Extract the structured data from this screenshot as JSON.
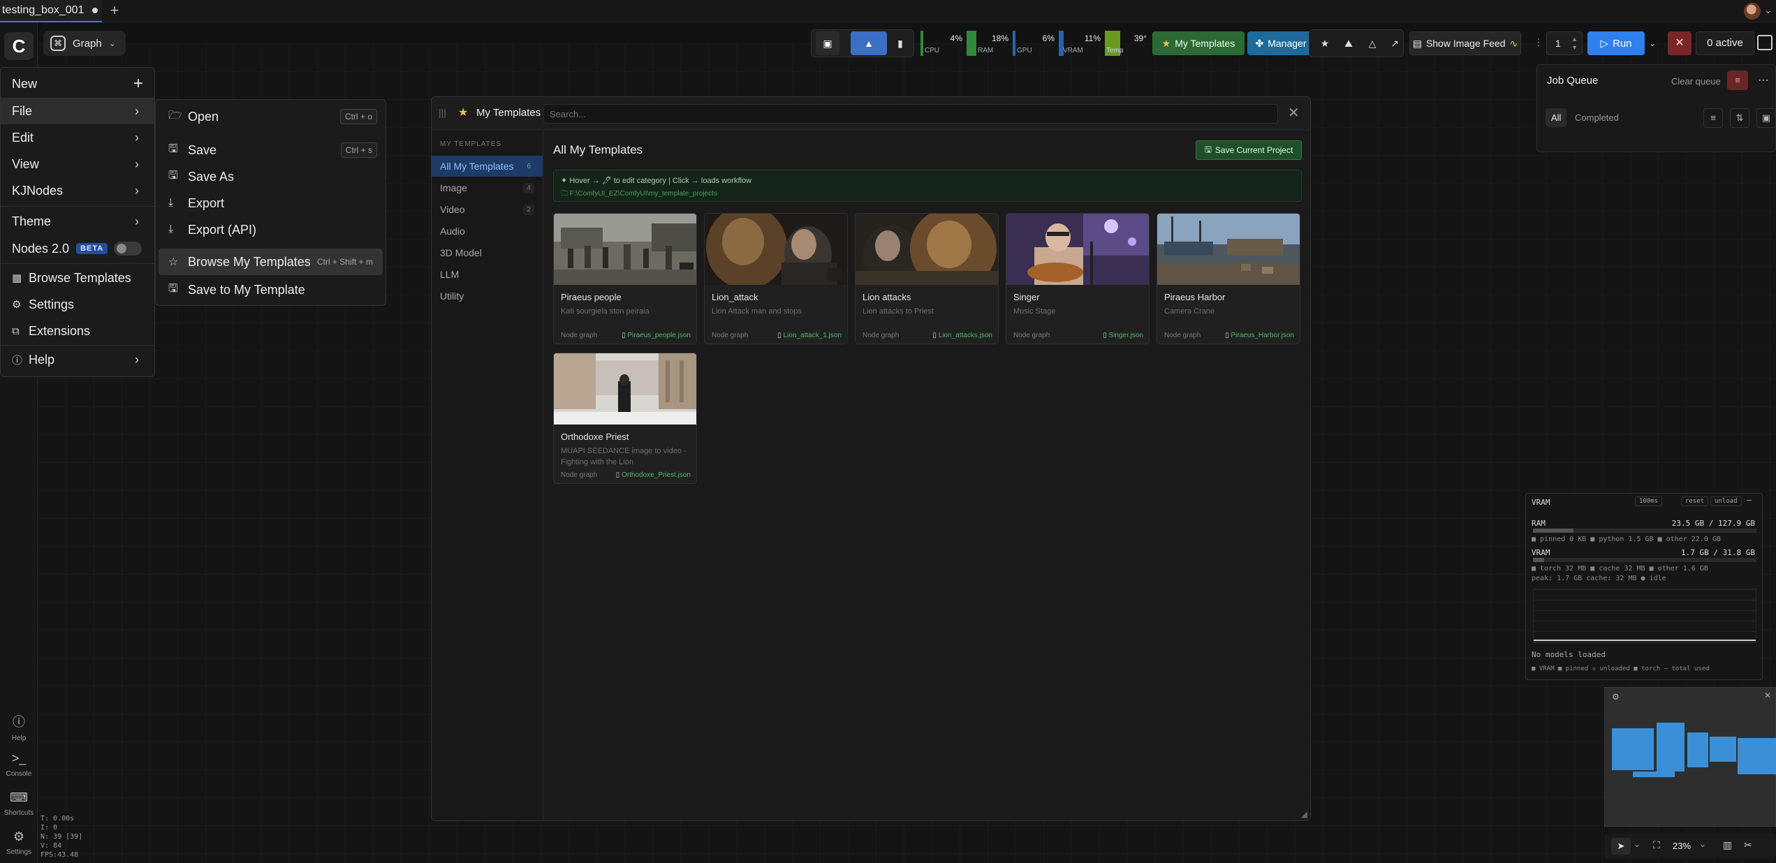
{
  "tabs": [
    {
      "label": "testing_box_001"
    }
  ],
  "graph_pill": {
    "label": "Graph"
  },
  "rail": {
    "help": "Help",
    "console": "Console",
    "shortcuts": "Shortcuts",
    "settings": "Settings"
  },
  "stats": {
    "t": "T: 0.00s",
    "i": "I: 0",
    "n": "N: 39 [39]",
    "v": "V: 84",
    "fps": "FPS:43.48"
  },
  "main_menu": {
    "new": "New",
    "file": "File",
    "edit": "Edit",
    "view": "View",
    "kjnodes": "KJNodes",
    "theme": "Theme",
    "nodes2": "Nodes 2.0",
    "beta": "BETA",
    "browse_templates": "Browse Templates",
    "settings": "Settings",
    "extensions": "Extensions",
    "help": "Help"
  },
  "file_menu": {
    "open": "Open",
    "open_kbd": "Ctrl + o",
    "save": "Save",
    "save_kbd": "Ctrl + s",
    "save_as": "Save As",
    "export": "Export",
    "export_api": "Export (API)",
    "browse_my_templates": "Browse My Templates",
    "browse_kbd": "Ctrl + Shift + m",
    "save_to_template": "Save to My Template"
  },
  "toolbar": {
    "cpu_label": "CPU",
    "cpu": "4%",
    "ram_label": "RAM",
    "ram": "18%",
    "gpu_label": "GPU",
    "gpu": "6%",
    "vram_label": "VRAM",
    "vram": "11%",
    "temp_label": "Temp",
    "temp": "39°",
    "my_templates": "My Templates",
    "manager": "Manager",
    "show_image_feed": "Show Image Feed",
    "batch": "1",
    "run": "Run",
    "active": "0 active"
  },
  "modal": {
    "title": "My Templates",
    "search_placeholder": "Search...",
    "section_label": "MY TEMPLATES",
    "categories": [
      {
        "label": "All My Templates",
        "count": "6"
      },
      {
        "label": "Image",
        "count": "4"
      },
      {
        "label": "Video",
        "count": "2"
      },
      {
        "label": "Audio",
        "count": ""
      },
      {
        "label": "3D Model",
        "count": ""
      },
      {
        "label": "LLM",
        "count": ""
      },
      {
        "label": "Utility",
        "count": ""
      }
    ],
    "heading": "All My Templates",
    "save_current": "Save Current Project",
    "hint": "✦ Hover → 🖊 to edit category  |  Click → loads workflow",
    "path": "F:\\ComfyUI_EZ\\ComfyUI\\my_template_projects",
    "cards": [
      {
        "title": "Piraeus people",
        "desc": "Kati sourgiela ston peiraia",
        "type": "Node graph",
        "file": "Piraeus_people.json"
      },
      {
        "title": "Lion_attack",
        "desc": "Lion Attack man and stops",
        "type": "Node graph",
        "file": "Lion_attack_1.json"
      },
      {
        "title": "Lion attacks",
        "desc": "Lion attacks to Priest",
        "type": "Node graph",
        "file": "Lion_attacks.json"
      },
      {
        "title": "Singer",
        "desc": "Music Stage",
        "type": "Node graph",
        "file": "Singer.json"
      },
      {
        "title": "Piraeus Harbor",
        "desc": "Camera Crane",
        "type": "Node graph",
        "file": "Piraeus_Harbor.json"
      },
      {
        "title": "Orthodoxe Priest",
        "desc": "MUAPI SEEDANCE image to video - Fighting with the Lion",
        "type": "Node graph",
        "file": "Orthodoxe_Priest.json"
      }
    ]
  },
  "job_queue": {
    "title": "Job Queue",
    "clear": "Clear queue",
    "all": "All",
    "completed": "Completed"
  },
  "vram_panel": {
    "title": "VRAM",
    "interval": "100ms",
    "reset": "reset",
    "unload": "unload",
    "ram_label": "RAM",
    "ram_value": "23.5 GB / 127.9 GB",
    "ram_detail": "■ pinned 0 KB  ■ python 1.5 GB  ■ other 22.0 GB",
    "vram_label": "VRAM",
    "vram_value": "1.7 GB / 31.8 GB",
    "vram_detail": "■ torch 32 MB  ■ cache 32 MB  ■ other 1.6 GB",
    "peak": "peak: 1.7 GB  cache: 32 MB  ● idle",
    "no_models": "No models loaded",
    "legend": "■ VRAM  ■ pinned  ▫ unloaded  ■ torch  — total used"
  },
  "zoom": {
    "value": "23%"
  },
  "colors": {
    "accent": "#3a78e8",
    "run": "#2f80ed",
    "green": "#2f6b3a",
    "manager": "#1f5f8b"
  }
}
